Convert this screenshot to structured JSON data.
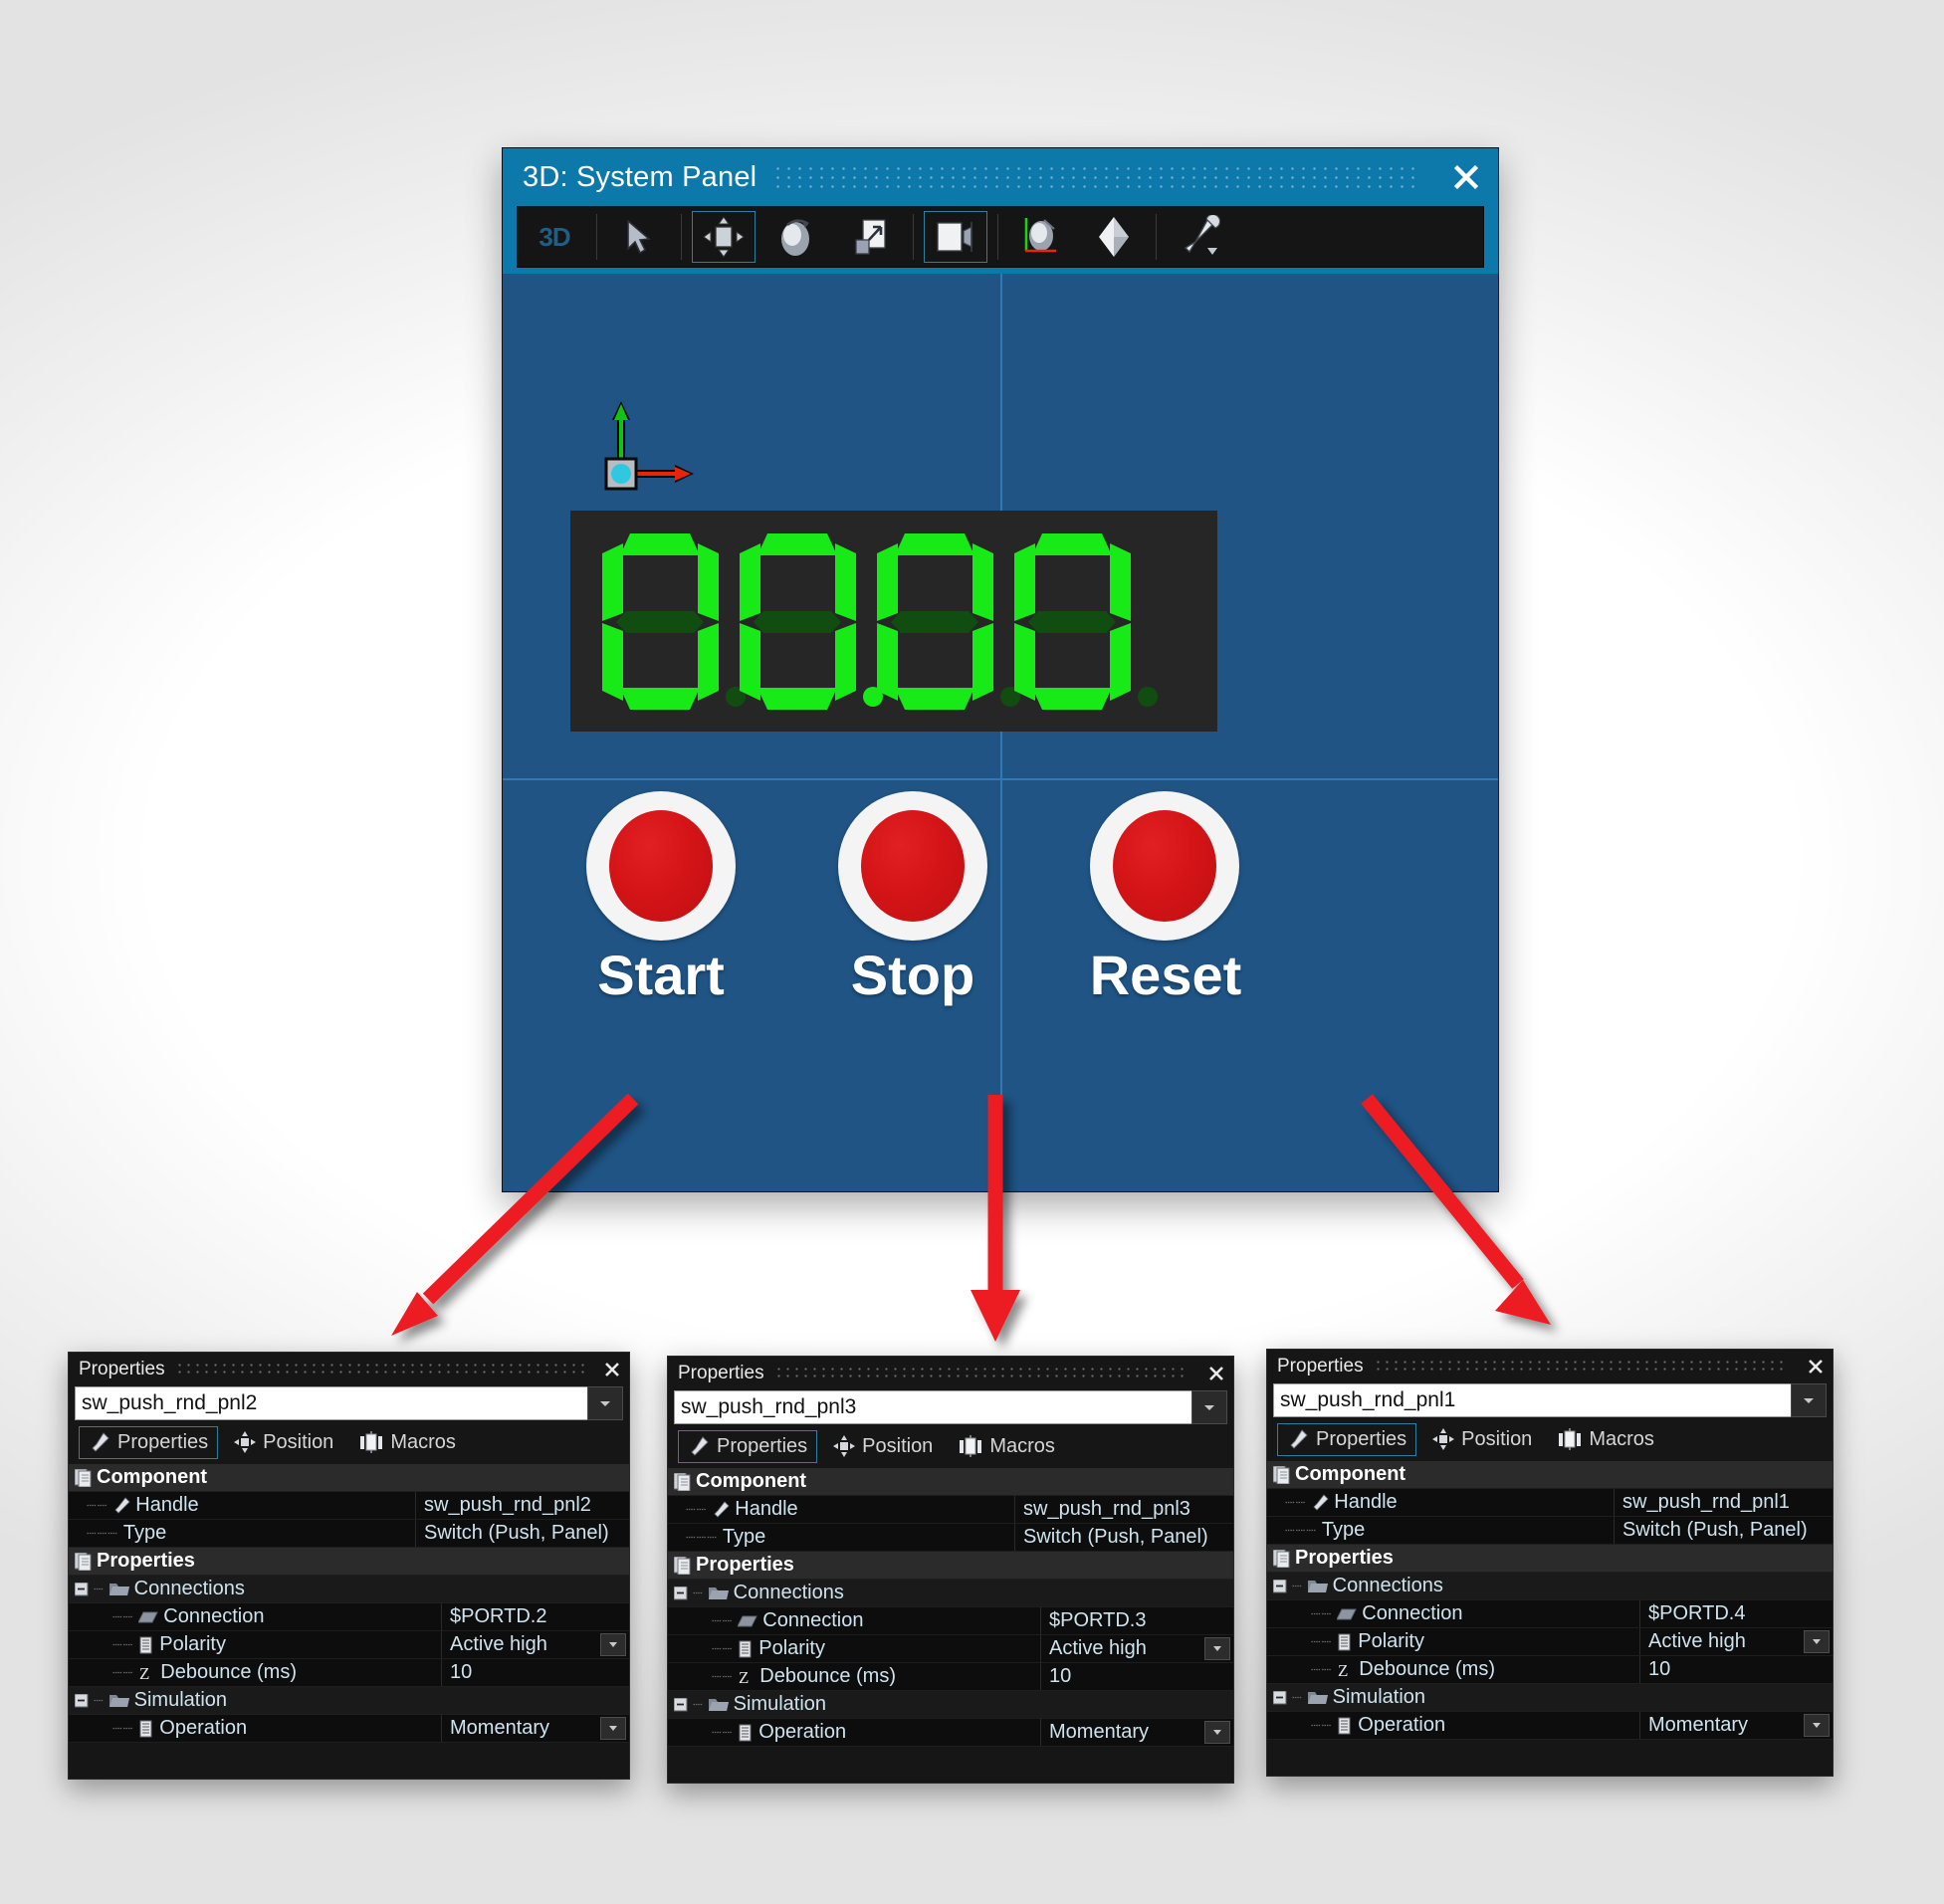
{
  "viewer": {
    "title": "3D: System Panel",
    "close_label": "×",
    "toolbar": {
      "mode_label": "3D",
      "buttons": [
        {
          "name": "select-tool",
          "icon": "cursor-arrow-icon",
          "selected": false
        },
        {
          "name": "move-tool",
          "icon": "move-arrows-icon",
          "selected": true
        },
        {
          "name": "rotate-tool",
          "icon": "sphere-rotate-icon",
          "selected": false
        },
        {
          "name": "scale-tool",
          "icon": "scale-diagonal-icon",
          "selected": false
        },
        {
          "name": "view-front-tool",
          "icon": "panel-view-icon",
          "selected": true
        },
        {
          "name": "axis-sphere-tool",
          "icon": "axis-sphere-icon",
          "selected": false
        },
        {
          "name": "shading-tool",
          "icon": "octahedron-icon",
          "selected": false
        },
        {
          "name": "settings-tool",
          "icon": "wrench-dropdown-icon",
          "selected": false
        }
      ]
    },
    "gizmo": {
      "x_axis_color": "#e8240c",
      "y_axis_color": "#12c412",
      "origin_color": "#2fc8e0"
    },
    "display": {
      "name": "seven-segment-display",
      "value": "00.00",
      "digit_count": 4,
      "decimal_after_digit": 2,
      "on_color": "#18ea18",
      "off_color": "#114d11",
      "background": "#262626"
    },
    "buttons": [
      {
        "label": "Start",
        "name": "start-push-button",
        "color": "#d41417"
      },
      {
        "label": "Stop",
        "name": "stop-push-button",
        "color": "#d41417"
      },
      {
        "label": "Reset",
        "name": "reset-push-button",
        "color": "#d41417"
      }
    ],
    "viewport_bg": "#1f5485",
    "guide_line_color": "#2f79b8"
  },
  "panels": [
    {
      "title": "Properties",
      "close_label": "×",
      "component_name": "sw_push_rnd_pnl2",
      "tabs": [
        {
          "label": "Properties",
          "icon": "wrench-icon",
          "active": true
        },
        {
          "label": "Position",
          "icon": "move-arrows-icon",
          "active": false
        },
        {
          "label": "Macros",
          "icon": "macros-icon",
          "active": false
        }
      ],
      "groups": [
        {
          "label": "Component",
          "icon": "document-stack-icon",
          "rows": [
            {
              "label": "Handle",
              "value": "sw_push_rnd_pnl2",
              "icon": "wrench-icon",
              "dropdown": false
            },
            {
              "label": "Type",
              "value": "Switch (Push, Panel)",
              "icon": "dash-icon",
              "dropdown": false
            }
          ]
        },
        {
          "label": "Properties",
          "icon": "document-stack-icon",
          "subgroups": [
            {
              "label": "Connections",
              "icon": "folder-icon",
              "expander": "minus-box-icon",
              "rows": [
                {
                  "label": "Connection",
                  "value": "$PORTD.2",
                  "icon": "parallelogram-icon",
                  "dropdown": false
                },
                {
                  "label": "Polarity",
                  "value": "Active high",
                  "icon": "list-icon",
                  "dropdown": true
                },
                {
                  "label": "Debounce (ms)",
                  "value": "10",
                  "icon": "z-icon",
                  "dropdown": false
                }
              ]
            },
            {
              "label": "Simulation",
              "icon": "folder-icon",
              "expander": "minus-box-icon",
              "rows": [
                {
                  "label": "Operation",
                  "value": "Momentary",
                  "icon": "list-icon",
                  "dropdown": true
                }
              ]
            }
          ]
        }
      ]
    },
    {
      "title": "Properties",
      "close_label": "×",
      "component_name": "sw_push_rnd_pnl3",
      "tabs": [
        {
          "label": "Properties",
          "icon": "wrench-icon",
          "active": true
        },
        {
          "label": "Position",
          "icon": "move-arrows-icon",
          "active": false
        },
        {
          "label": "Macros",
          "icon": "macros-icon",
          "active": false
        }
      ],
      "groups": [
        {
          "label": "Component",
          "icon": "document-stack-icon",
          "rows": [
            {
              "label": "Handle",
              "value": "sw_push_rnd_pnl3",
              "icon": "wrench-icon",
              "dropdown": false
            },
            {
              "label": "Type",
              "value": "Switch (Push, Panel)",
              "icon": "dash-icon",
              "dropdown": false
            }
          ]
        },
        {
          "label": "Properties",
          "icon": "document-stack-icon",
          "subgroups": [
            {
              "label": "Connections",
              "icon": "folder-icon",
              "expander": "minus-box-icon",
              "rows": [
                {
                  "label": "Connection",
                  "value": "$PORTD.3",
                  "icon": "parallelogram-icon",
                  "dropdown": false
                },
                {
                  "label": "Polarity",
                  "value": "Active high",
                  "icon": "list-icon",
                  "dropdown": true
                },
                {
                  "label": "Debounce (ms)",
                  "value": "10",
                  "icon": "z-icon",
                  "dropdown": false
                }
              ]
            },
            {
              "label": "Simulation",
              "icon": "folder-icon",
              "expander": "minus-box-icon",
              "rows": [
                {
                  "label": "Operation",
                  "value": "Momentary",
                  "icon": "list-icon",
                  "dropdown": true
                }
              ]
            }
          ]
        }
      ]
    },
    {
      "title": "Properties",
      "close_label": "×",
      "component_name": "sw_push_rnd_pnl1",
      "tabs": [
        {
          "label": "Properties",
          "icon": "wrench-icon",
          "active": true
        },
        {
          "label": "Position",
          "icon": "move-arrows-icon",
          "active": false
        },
        {
          "label": "Macros",
          "icon": "macros-icon",
          "active": false
        }
      ],
      "groups": [
        {
          "label": "Component",
          "icon": "document-stack-icon",
          "rows": [
            {
              "label": "Handle",
              "value": "sw_push_rnd_pnl1",
              "icon": "wrench-icon",
              "dropdown": false
            },
            {
              "label": "Type",
              "value": "Switch (Push, Panel)",
              "icon": "dash-icon",
              "dropdown": false
            }
          ]
        },
        {
          "label": "Properties",
          "icon": "document-stack-icon",
          "subgroups": [
            {
              "label": "Connections",
              "icon": "folder-icon",
              "expander": "minus-box-icon",
              "rows": [
                {
                  "label": "Connection",
                  "value": "$PORTD.4",
                  "icon": "parallelogram-icon",
                  "dropdown": false
                },
                {
                  "label": "Polarity",
                  "value": "Active high",
                  "icon": "list-icon",
                  "dropdown": true
                },
                {
                  "label": "Debounce (ms)",
                  "value": "10",
                  "icon": "z-icon",
                  "dropdown": false
                }
              ]
            },
            {
              "label": "Simulation",
              "icon": "folder-icon",
              "expander": "minus-box-icon",
              "rows": [
                {
                  "label": "Operation",
                  "value": "Momentary",
                  "icon": "list-icon",
                  "dropdown": true
                }
              ]
            }
          ]
        }
      ]
    }
  ],
  "annotations": {
    "arrow_color": "#ec1c24",
    "arrows": [
      {
        "name": "arrow-to-start-panel",
        "from_button": "Start"
      },
      {
        "name": "arrow-to-stop-panel",
        "from_button": "Stop"
      },
      {
        "name": "arrow-to-reset-panel",
        "from_button": "Reset"
      }
    ]
  }
}
